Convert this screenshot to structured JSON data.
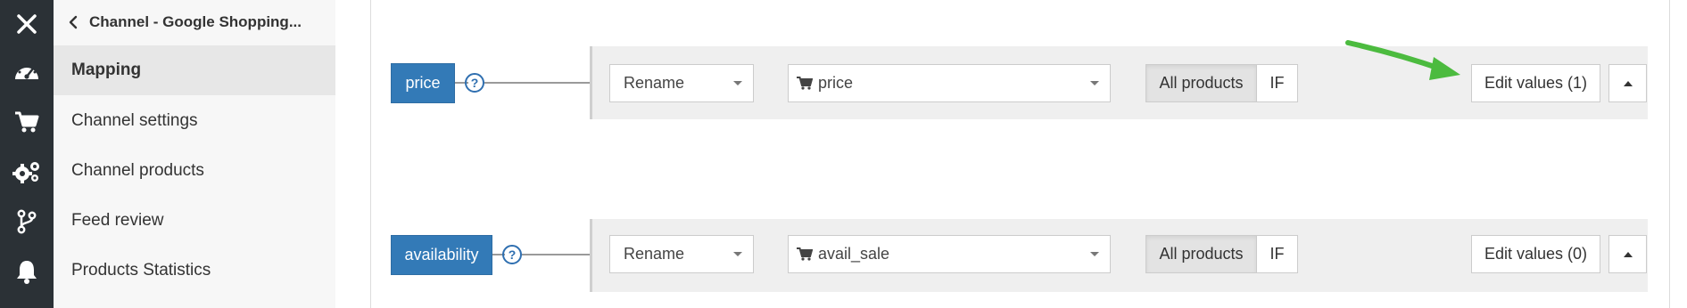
{
  "rail": {
    "close_icon": "close-icon",
    "icons": [
      "dashboard-icon",
      "cart-icon",
      "gears-icon",
      "branch-icon",
      "bell-icon"
    ],
    "bg_color": "#2b3136"
  },
  "sidebar": {
    "title": "Channel - Google Shopping...",
    "items": [
      {
        "label": "Mapping",
        "active": true
      },
      {
        "label": "Channel settings",
        "active": false
      },
      {
        "label": "Channel products",
        "active": false
      },
      {
        "label": "Feed review",
        "active": false
      },
      {
        "label": "Products Statistics",
        "active": false
      }
    ]
  },
  "mapping": {
    "rows": [
      {
        "field": "price",
        "help": "?",
        "mode": "Rename",
        "source": "price",
        "all_products": "All products",
        "if_label": "IF",
        "edit_values": "Edit values (1)"
      },
      {
        "field": "availability",
        "help": "?",
        "mode": "Rename",
        "source": "avail_sale",
        "all_products": "All products",
        "if_label": "IF",
        "edit_values": "Edit values (0)"
      }
    ]
  },
  "colors": {
    "field_tag": "#337ab7",
    "annotation_arrow": "#4cbb3f"
  }
}
